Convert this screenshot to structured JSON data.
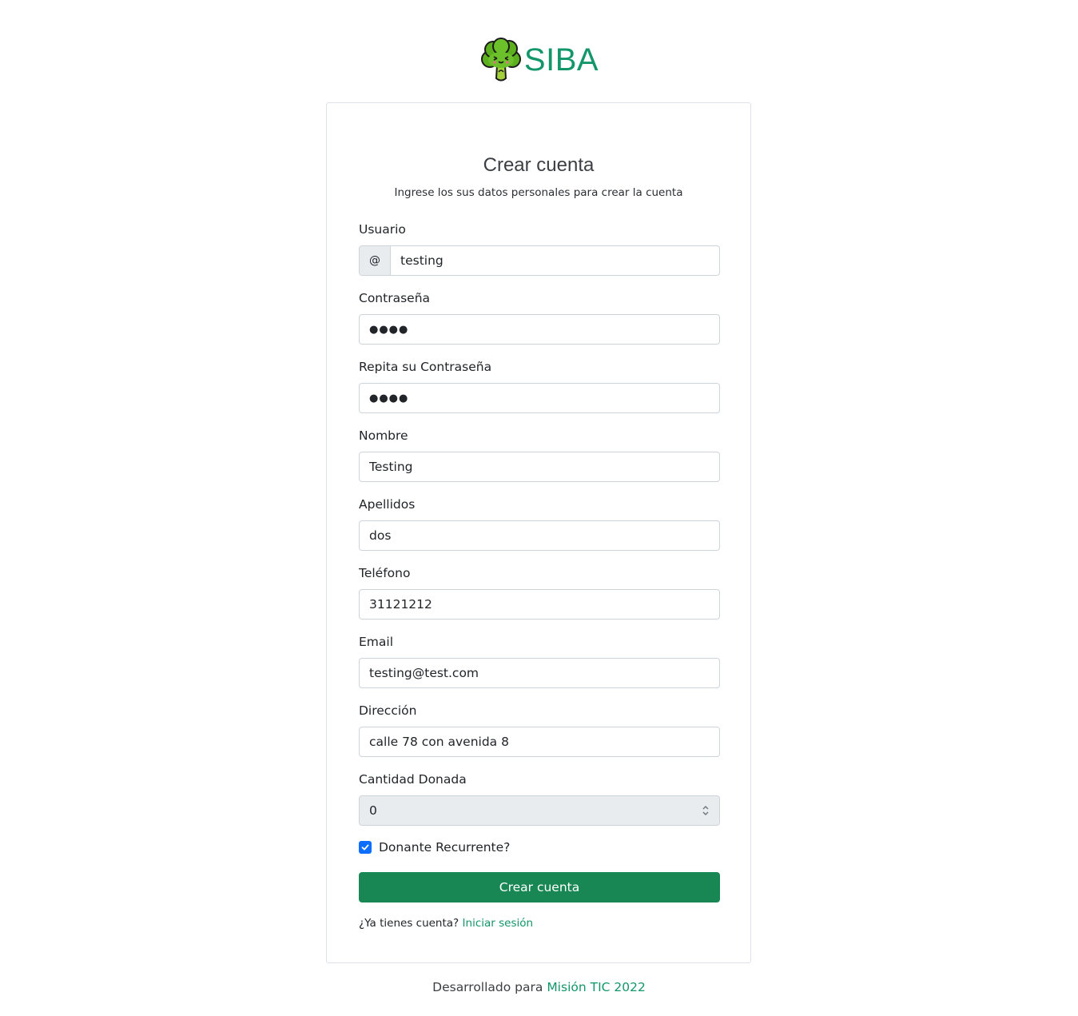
{
  "brand": {
    "logo_icon": "broccoli-logo-icon",
    "name": "SIBA",
    "color": "#12966a"
  },
  "form": {
    "title": "Crear cuenta",
    "subtitle": "Ingrese los sus datos personales para crear la cuenta",
    "usuario": {
      "label": "Usuario",
      "prefix": "@",
      "value": "testing"
    },
    "contrasena": {
      "label": "Contraseña",
      "value": "●●●●"
    },
    "repita": {
      "label": "Repita su Contraseña",
      "value": "●●●●"
    },
    "nombre": {
      "label": "Nombre",
      "value": "Testing"
    },
    "apellidos": {
      "label": "Apellidos",
      "value": "dos"
    },
    "telefono": {
      "label": "Teléfono",
      "value": "31121212"
    },
    "email": {
      "label": "Email",
      "value": "testing@test.com"
    },
    "direccion": {
      "label": "Dirección",
      "value": "calle 78 con avenida 8"
    },
    "cantidad": {
      "label": "Cantidad Donada",
      "value": "0"
    },
    "recurrente": {
      "label": "Donante Recurrente?",
      "checked": true
    },
    "submit_label": "Crear cuenta",
    "login_prompt": "¿Ya tienes cuenta?",
    "login_link": "Iniciar sesión"
  },
  "footer": {
    "text": "Desarrollado para",
    "link": "Misión TIC 2022"
  },
  "colors": {
    "primary_button": "#198754",
    "checkbox": "#0d6efd",
    "link": "#12966a"
  }
}
